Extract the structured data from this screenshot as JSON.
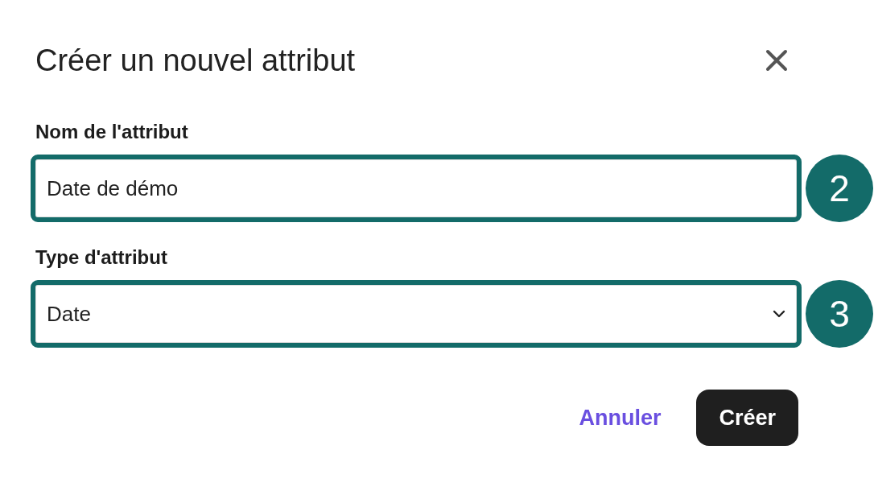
{
  "dialog": {
    "title": "Créer un nouvel attribut"
  },
  "fields": [
    {
      "kind": "text",
      "label": "Nom de l'attribut",
      "value": "Date de démo",
      "highlighted": true,
      "step": "2"
    },
    {
      "kind": "select",
      "label": "Type d'attribut",
      "value": "Date",
      "highlighted": true,
      "step": "3"
    }
  ],
  "buttons": [
    {
      "kind": "link",
      "label": "Annuler"
    },
    {
      "kind": "primary",
      "label": "Créer"
    }
  ]
}
